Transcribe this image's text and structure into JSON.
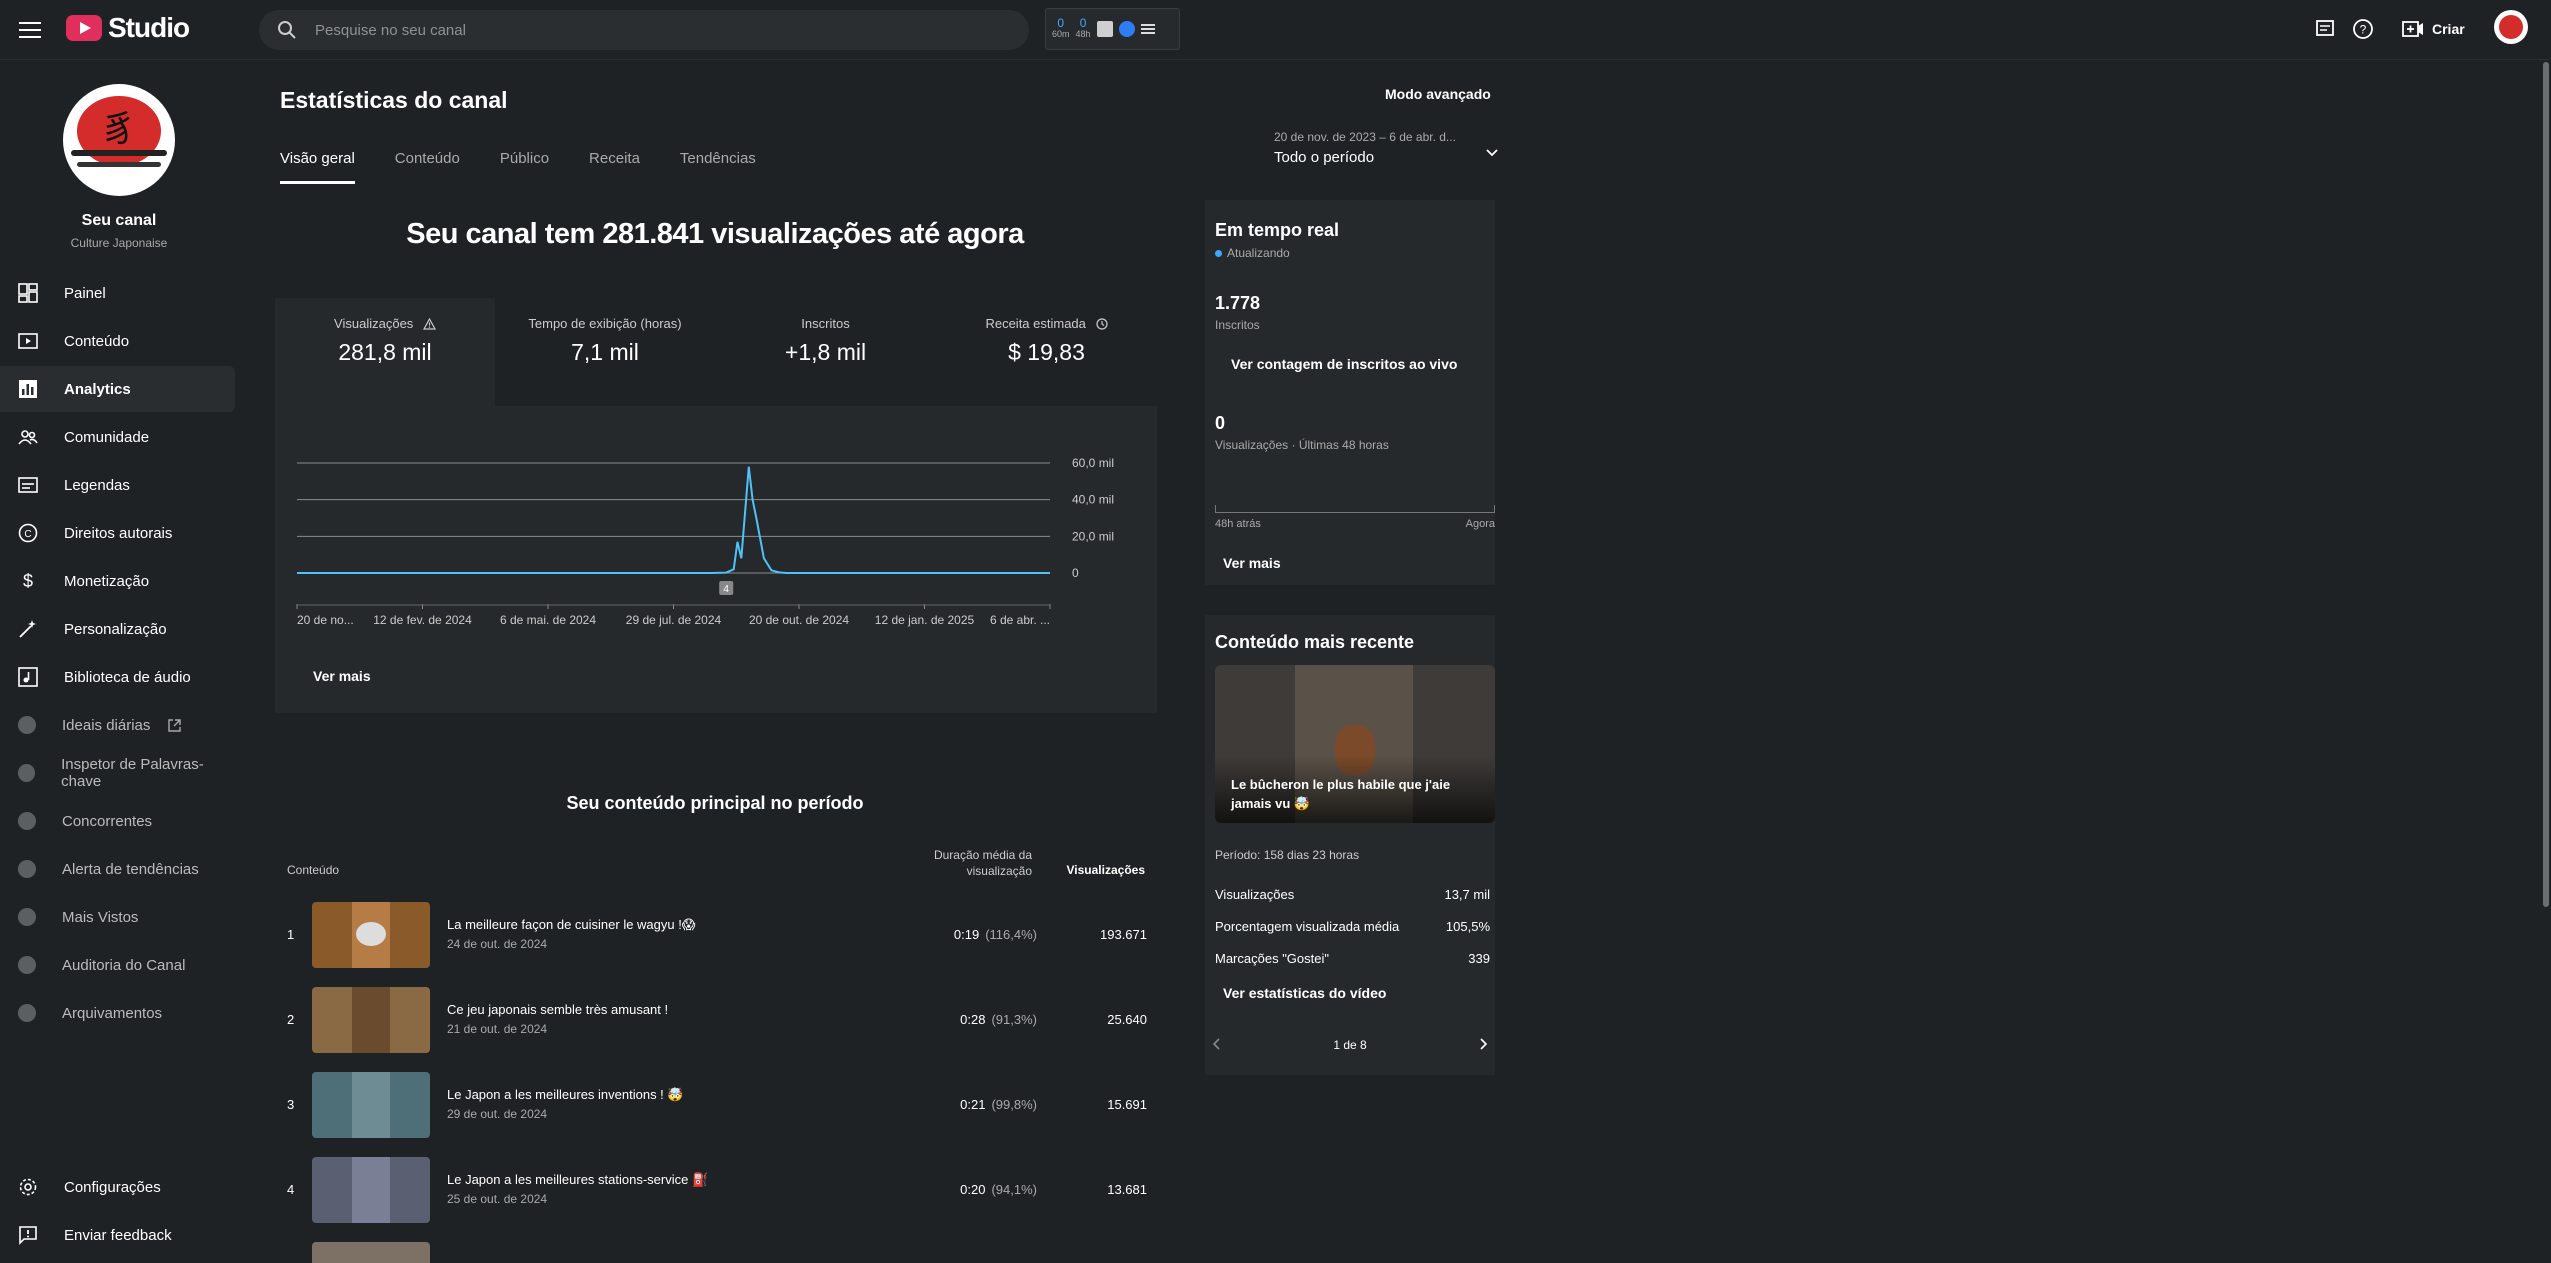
{
  "topbar": {
    "logo_text": "Studio",
    "search_placeholder": "Pesquise no seu canal",
    "ext_stat1_value": "0",
    "ext_stat1_label": "60m",
    "ext_stat2_value": "0",
    "ext_stat2_label": "48h",
    "create_label": "Criar"
  },
  "sidebar": {
    "channel_name": "Seu canal",
    "channel_subtitle": "Culture Japonaise",
    "items": [
      {
        "label": "Painel",
        "icon": "dashboard-icon"
      },
      {
        "label": "Conteúdo",
        "icon": "content-icon"
      },
      {
        "label": "Analytics",
        "icon": "analytics-icon"
      },
      {
        "label": "Comunidade",
        "icon": "community-icon"
      },
      {
        "label": "Legendas",
        "icon": "subtitles-icon"
      },
      {
        "label": "Direitos autorais",
        "icon": "copyright-icon"
      },
      {
        "label": "Monetização",
        "icon": "dollar-icon"
      },
      {
        "label": "Personalização",
        "icon": "wand-icon"
      },
      {
        "label": "Biblioteca de áudio",
        "icon": "audio-library-icon"
      }
    ],
    "ext_items": [
      "Ideais diárias",
      "Inspetor de Palavras-chave",
      "Concorrentes",
      "Alerta de tendências",
      "Mais Vistos",
      "Auditoria do Canal",
      "Arquivamentos"
    ],
    "settings_label": "Configurações",
    "feedback_label": "Enviar feedback"
  },
  "header": {
    "title": "Estatísticas do canal",
    "advanced_mode": "Modo avançado",
    "period_range": "20 de nov. de 2023 – 6 de abr. d...",
    "period_label": "Todo o período",
    "tabs": [
      "Visão geral",
      "Conteúdo",
      "Público",
      "Receita",
      "Tendências"
    ]
  },
  "overview": {
    "headline": "Seu canal tem 281.841 visualizações até agora",
    "metrics": [
      {
        "label": "Visualizações",
        "value": "281,8 mil"
      },
      {
        "label": "Tempo de exibição (horas)",
        "value": "7,1 mil"
      },
      {
        "label": "Inscritos",
        "value": "+1,8 mil"
      },
      {
        "label": "Receita estimada",
        "value": "$ 19,83"
      }
    ],
    "see_more": "Ver mais"
  },
  "chart_data": {
    "type": "line",
    "x_tick_labels": [
      "20 de no...",
      "12 de fev. de 2024",
      "6 de mai. de 2024",
      "29 de jul. de 2024",
      "20 de out. de 2024",
      "12 de jan. de 2025",
      "6 de abr. ..."
    ],
    "y_tick_labels": [
      "60,0 mil",
      "40,0 mil",
      "20,0 mil",
      "0"
    ],
    "ylim": [
      0,
      60000
    ],
    "grid": true,
    "marker_label": "4",
    "series": [
      {
        "x": [
          0,
          0.55,
          0.57,
          0.58,
          0.585,
          0.59,
          0.6,
          0.605,
          0.61,
          0.62,
          0.63,
          0.64,
          0.65,
          1
        ],
        "values": [
          0,
          0,
          200,
          2000,
          17000,
          8000,
          58000,
          40000,
          30000,
          8000,
          1500,
          300,
          0,
          0
        ]
      }
    ]
  },
  "top_content": {
    "title": "Seu conteúdo principal no período",
    "col_content": "Conteúdo",
    "col_duration": "Duração média da visualização",
    "col_views": "Visualizações",
    "rows": [
      {
        "n": "1",
        "title": "La meilleure façon de cuisiner le wagyu !😱",
        "date": "24 de out. de 2024",
        "dur": "0:19",
        "pct": "(116,4%)",
        "views": "193.671"
      },
      {
        "n": "2",
        "title": "Ce jeu japonais semble très amusant !",
        "date": "21 de out. de 2024",
        "dur": "0:28",
        "pct": "(91,3%)",
        "views": "25.640"
      },
      {
        "n": "3",
        "title": "Le Japon a les meilleures inventions ! 🤯",
        "date": "29 de out. de 2024",
        "dur": "0:21",
        "pct": "(99,8%)",
        "views": "15.691"
      },
      {
        "n": "4",
        "title": "Le Japon a les meilleures stations-service ⛽",
        "date": "25 de out. de 2024",
        "dur": "0:20",
        "pct": "(94,1%)",
        "views": "13.681"
      }
    ]
  },
  "realtime": {
    "title": "Em tempo real",
    "status": "Atualizando",
    "subs_value": "1.778",
    "subs_label": "Inscritos",
    "live_button": "Ver contagem de inscritos ao vivo",
    "views_value": "0",
    "views_label": "Visualizações · Últimas 48 horas",
    "left_label": "48h atrás",
    "right_label": "Agora",
    "see_more": "Ver mais"
  },
  "recent": {
    "title": "Conteúdo mais recente",
    "video_title": "Le bûcheron le plus habile que j'aie jamais vu 🤯",
    "period": "Período: 158 dias 23 horas",
    "stats": [
      {
        "label": "Visualizações",
        "value": "13,7 mil"
      },
      {
        "label": "Porcentagem visualizada média",
        "value": "105,5%"
      },
      {
        "label": "Marcações \"Gostei\"",
        "value": "339"
      }
    ],
    "stats_button": "Ver estatísticas do vídeo",
    "pager": "1 de 8"
  },
  "colors": {
    "bg": "#1f2224",
    "card": "#26292b",
    "accent": "#3ea6ff",
    "line": "#4fc3f7"
  }
}
